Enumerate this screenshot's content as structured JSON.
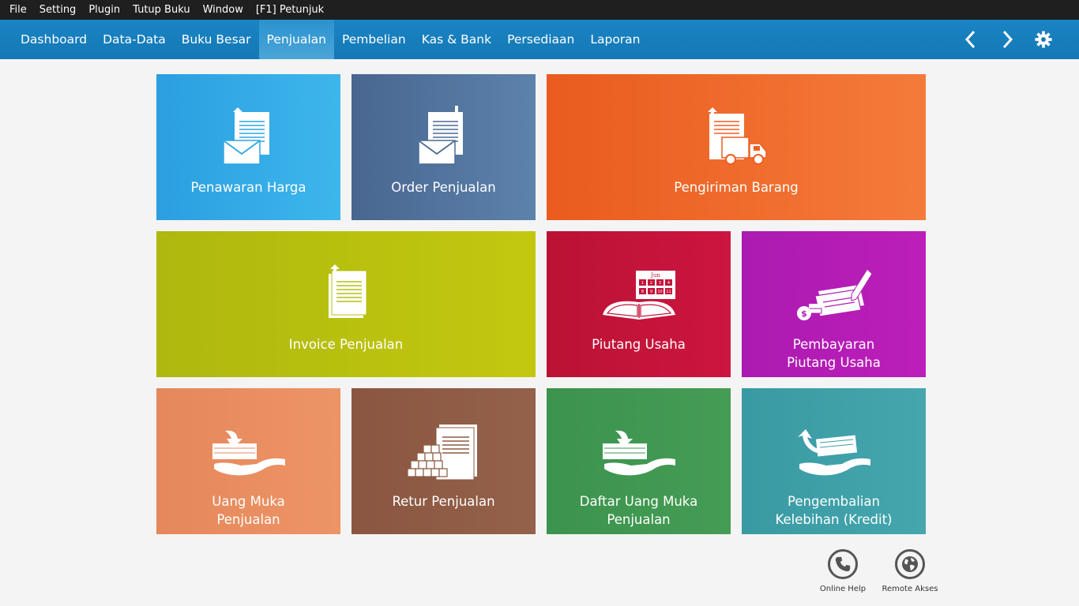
{
  "menubar": [
    "File",
    "Setting",
    "Plugin",
    "Tutup Buku",
    "Window",
    "[F1] Petunjuk"
  ],
  "nav": {
    "tabs": [
      "Dashboard",
      "Data-Data",
      "Buku Besar",
      "Penjualan",
      "Pembelian",
      "Kas & Bank",
      "Persediaan",
      "Laporan"
    ],
    "active": "Penjualan",
    "icons": [
      "chevron-left-icon",
      "chevron-right-icon",
      "gear-icon"
    ]
  },
  "tiles": {
    "penawaran": {
      "line1": "Penawaran Harga",
      "line2": "",
      "color": "#2ea6e3"
    },
    "order": {
      "line1": "Order Penjualan",
      "line2": "",
      "color": "#4b6b94"
    },
    "pengiriman": {
      "line1": "Pengiriman Barang",
      "line2": "",
      "color": "#ef5f22"
    },
    "invoice": {
      "line1": "Invoice Penjualan",
      "line2": "",
      "color": "#b6bf10"
    },
    "piutang": {
      "line1": "Piutang Usaha",
      "line2": "",
      "color": "#c31339"
    },
    "pembayaran": {
      "line1": "Pembayaran",
      "line2": "Piutang Usaha",
      "color": "#b21bb3"
    },
    "uangmuka": {
      "line1": "Uang Muka",
      "line2": "Penjualan",
      "color": "#e88a5e"
    },
    "retur": {
      "line1": "Retur Penjualan",
      "line2": "",
      "color": "#8c5a42"
    },
    "daftar": {
      "line1": "Daftar Uang Muka",
      "line2": "Penjualan",
      "color": "#3f9650"
    },
    "pengembalian": {
      "line1": "Pengembalian",
      "line2": "Kelebihan (Kredit)",
      "color": "#3c9ea6"
    }
  },
  "calendar": {
    "month": "Jun",
    "days": [
      "1",
      "2",
      "3",
      "4",
      "8",
      "9",
      "10",
      "11"
    ]
  },
  "footer": {
    "help": "Online Help",
    "remote": "Remote Akses"
  }
}
